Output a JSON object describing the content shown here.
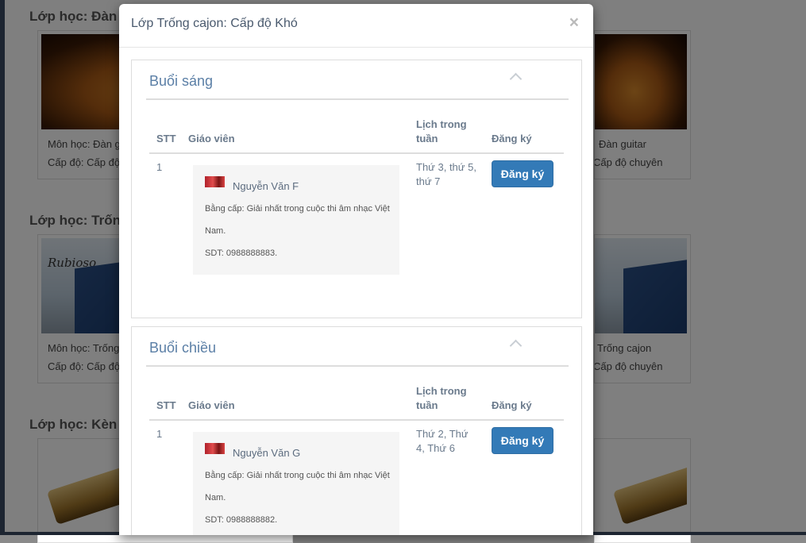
{
  "background": {
    "categories": [
      {
        "title": "Lớp học: Đàn g",
        "left_lines": [
          "Môn học: Đàn g",
          "Cấp độ: Cấp độ"
        ],
        "right_lines": [
          "Đàn guitar",
          "Cấp độ chuyên"
        ]
      },
      {
        "title": "Lớp học: Trống",
        "left_lines": [
          "Môn học: Trống",
          "Cấp độ: Cấp độ"
        ],
        "right_lines": [
          "Trống cajon",
          "Cấp độ chuyên"
        ],
        "script_text": "Rubioso"
      },
      {
        "title": "Lớp học: Kèn h"
      }
    ]
  },
  "modal": {
    "title": "Lớp Trống cajon: Cấp độ Khó",
    "close_label": "×",
    "columns": {
      "stt": "STT",
      "teacher": "Giáo viên",
      "schedule": "Lịch trong tuần",
      "register": "Đăng ký"
    },
    "sessions": [
      {
        "title": "Buổi sáng",
        "row": {
          "stt": "1",
          "teacher_name": "Nguyễn Văn F",
          "degree": "Bằng cấp: Giải nhất trong cuộc thi âm nhạc Việt Nam.",
          "phone": "SDT: 0988888883.",
          "schedule": "Thứ 3, thứ 5, thứ 7",
          "button": "Đăng ký"
        }
      },
      {
        "title": "Buổi chiều",
        "row": {
          "stt": "1",
          "teacher_name": "Nguyễn Văn G",
          "degree": "Bằng cấp: Giải nhất trong cuộc thi âm nhạc Việt Nam.",
          "phone": "SDT: 0988888882.",
          "schedule": "Thứ 2, Thứ 4, Thứ 6",
          "button": "Đăng ký"
        }
      }
    ]
  },
  "colors": {
    "primary_button": "#337ab7",
    "panel_title": "#5b7fa6",
    "overlay": "rgba(0,0,0,0.5)"
  }
}
